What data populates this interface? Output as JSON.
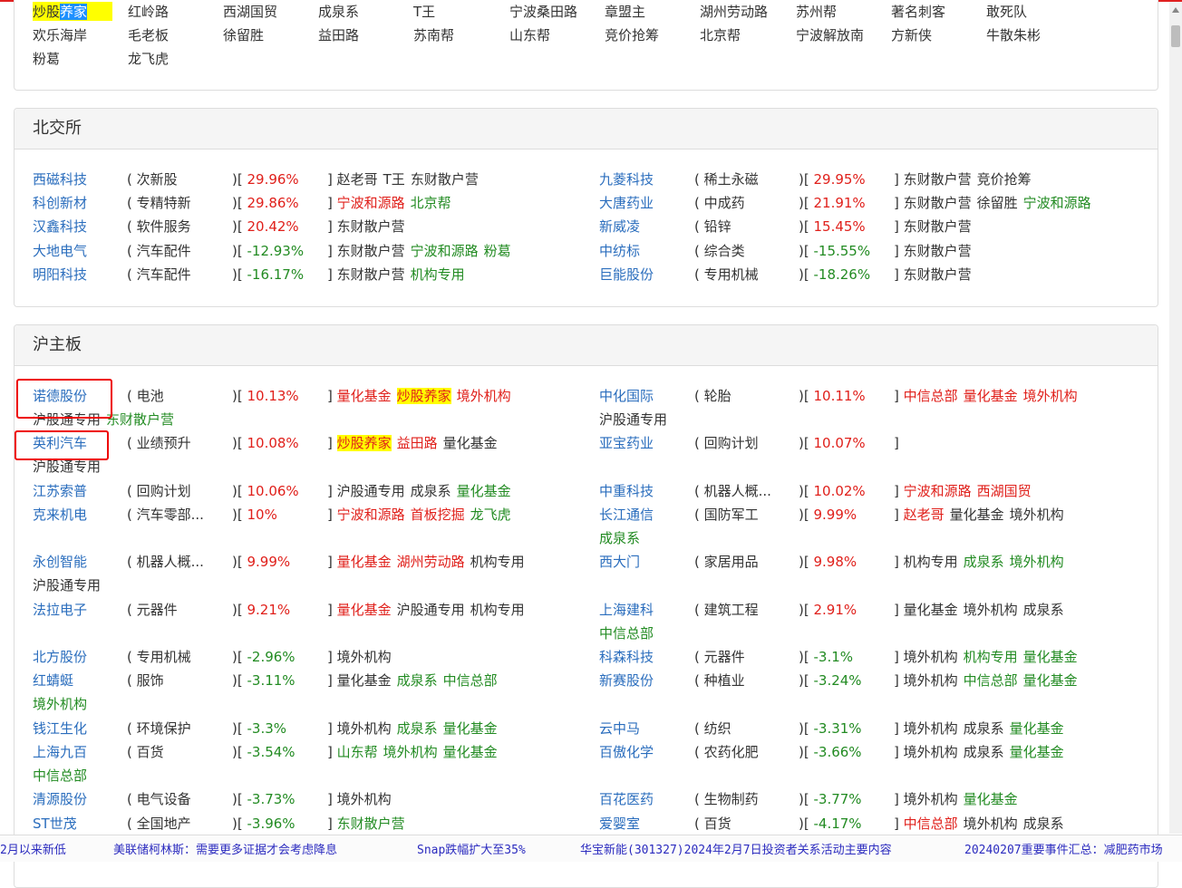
{
  "seats": [
    [
      "炒股养家",
      "红岭路",
      "西湖国贸",
      "成泉系",
      "T王",
      "宁波桑田路",
      "章盟主",
      "湖州劳动路",
      "苏州帮",
      "著名刺客",
      "敢死队"
    ],
    [
      "欢乐海岸",
      "毛老板",
      "徐留胜",
      "益田路",
      "苏南帮",
      "山东帮",
      "竞价抢筹",
      "北京帮",
      "宁波解放南",
      "方新侠",
      "牛散朱彬"
    ],
    [
      "粉葛",
      "龙飞虎"
    ]
  ],
  "sections": [
    {
      "title": "北交所",
      "rows": [
        {
          "left": {
            "name": "西磁科技",
            "industry": "次新股",
            "pct": "29.96%",
            "dir": "up",
            "tags": [
              {
                "t": "赵老哥",
                "c": "black"
              },
              {
                "t": "T王",
                "c": "black"
              },
              {
                "t": "东财散户营",
                "c": "black"
              }
            ]
          },
          "right": {
            "name": "九菱科技",
            "industry": "稀土永磁",
            "pct": "29.95%",
            "dir": "up",
            "tags": [
              {
                "t": "东财散户营",
                "c": "black"
              },
              {
                "t": "竞价抢筹",
                "c": "black"
              }
            ]
          }
        },
        {
          "left": {
            "name": "科创新材",
            "industry": "专精特新",
            "pct": "29.86%",
            "dir": "up",
            "tags": [
              {
                "t": "宁波和源路",
                "c": "red"
              },
              {
                "t": "北京帮",
                "c": "green"
              }
            ]
          },
          "right": {
            "name": "大唐药业",
            "industry": "中成药",
            "pct": "21.91%",
            "dir": "up",
            "tags": [
              {
                "t": "东财散户营",
                "c": "black"
              },
              {
                "t": "徐留胜",
                "c": "black"
              },
              {
                "t": "宁波和源路",
                "c": "green"
              }
            ]
          }
        },
        {
          "left": {
            "name": "汉鑫科技",
            "industry": "软件服务",
            "pct": "20.42%",
            "dir": "up",
            "tags": [
              {
                "t": "东财散户营",
                "c": "black"
              }
            ]
          },
          "right": {
            "name": "新威凌",
            "industry": "铅锌",
            "pct": "15.45%",
            "dir": "up",
            "tags": [
              {
                "t": "东财散户营",
                "c": "black"
              }
            ]
          }
        },
        {
          "left": {
            "name": "大地电气",
            "industry": "汽车配件",
            "pct": "-12.93%",
            "dir": "dn",
            "tags": [
              {
                "t": "东财散户营",
                "c": "black"
              },
              {
                "t": "宁波和源路",
                "c": "green"
              },
              {
                "t": "粉葛",
                "c": "green"
              }
            ]
          },
          "right": {
            "name": "中纺标",
            "industry": "综合类",
            "pct": "-15.55%",
            "dir": "dn",
            "tags": [
              {
                "t": "东财散户营",
                "c": "black"
              }
            ]
          }
        },
        {
          "left": {
            "name": "明阳科技",
            "industry": "汽车配件",
            "pct": "-16.17%",
            "dir": "dn",
            "tags": [
              {
                "t": "东财散户营",
                "c": "black"
              },
              {
                "t": "机构专用",
                "c": "green"
              }
            ]
          },
          "right": {
            "name": "巨能股份",
            "industry": "专用机械",
            "pct": "-18.26%",
            "dir": "dn",
            "tags": [
              {
                "t": "东财散户营",
                "c": "black"
              }
            ]
          }
        }
      ]
    },
    {
      "title": "沪主板",
      "rows": [
        {
          "left": {
            "name": "诺德股份",
            "industry": "电池",
            "pct": "10.13%",
            "dir": "up",
            "tags": [
              {
                "t": "量化基金",
                "c": "red"
              },
              {
                "t": "炒股养家",
                "c": "hl"
              },
              {
                "t": "境外机构",
                "c": "red"
              }
            ]
          },
          "right": {
            "name": "中化国际",
            "industry": "轮胎",
            "pct": "10.11%",
            "dir": "up",
            "tags": [
              {
                "t": "中信总部",
                "c": "red"
              },
              {
                "t": "量化基金",
                "c": "red"
              },
              {
                "t": "境外机构",
                "c": "red"
              }
            ]
          },
          "lcont": [
            {
              "t": "沪股通专用",
              "c": "black"
            },
            {
              "t": "东财散户营",
              "c": "green"
            }
          ],
          "rcont": [
            {
              "t": "沪股通专用",
              "c": "black"
            }
          ]
        },
        {
          "left": {
            "name": "英利汽车",
            "industry": "业绩预升",
            "pct": "10.08%",
            "dir": "up",
            "tags": [
              {
                "t": "炒股养家",
                "c": "hl"
              },
              {
                "t": "益田路",
                "c": "red"
              },
              {
                "t": "量化基金",
                "c": "black"
              }
            ]
          },
          "right": {
            "name": "亚宝药业",
            "industry": "回购计划",
            "pct": "10.07%",
            "dir": "up",
            "tags": []
          },
          "lcont": [
            {
              "t": "沪股通专用",
              "c": "black"
            }
          ],
          "rcont": []
        },
        {
          "left": {
            "name": "江苏索普",
            "industry": "回购计划",
            "pct": "10.06%",
            "dir": "up",
            "tags": [
              {
                "t": "沪股通专用",
                "c": "black"
              },
              {
                "t": "成泉系",
                "c": "black"
              },
              {
                "t": "量化基金",
                "c": "green"
              }
            ]
          },
          "right": {
            "name": "中重科技",
            "industry": "机器人概...",
            "pct": "10.02%",
            "dir": "up",
            "tags": [
              {
                "t": "宁波和源路",
                "c": "red"
              },
              {
                "t": "西湖国贸",
                "c": "red"
              }
            ]
          }
        },
        {
          "left": {
            "name": "克来机电",
            "industry": "汽车零部...",
            "pct": "10%",
            "dir": "up",
            "tags": [
              {
                "t": "宁波和源路",
                "c": "red"
              },
              {
                "t": "首板挖掘",
                "c": "red"
              },
              {
                "t": "龙飞虎",
                "c": "green"
              }
            ]
          },
          "right": {
            "name": "长江通信",
            "industry": "国防军工",
            "pct": "9.99%",
            "dir": "up",
            "tags": [
              {
                "t": "赵老哥",
                "c": "red"
              },
              {
                "t": "量化基金",
                "c": "black"
              },
              {
                "t": "境外机构",
                "c": "black"
              }
            ]
          },
          "lcont": [],
          "rcont": [
            {
              "t": "成泉系",
              "c": "green"
            }
          ]
        },
        {
          "left": {
            "name": "永创智能",
            "industry": "机器人概...",
            "pct": "9.99%",
            "dir": "up",
            "tags": [
              {
                "t": "量化基金",
                "c": "red"
              },
              {
                "t": "湖州劳动路",
                "c": "red"
              },
              {
                "t": "机构专用",
                "c": "black"
              }
            ]
          },
          "right": {
            "name": "西大门",
            "industry": "家居用品",
            "pct": "9.98%",
            "dir": "up",
            "tags": [
              {
                "t": "机构专用",
                "c": "black"
              },
              {
                "t": "成泉系",
                "c": "green"
              },
              {
                "t": "境外机构",
                "c": "green"
              }
            ]
          },
          "lcont": [
            {
              "t": "沪股通专用",
              "c": "black"
            }
          ],
          "rcont": []
        },
        {
          "left": {
            "name": "法拉电子",
            "industry": "元器件",
            "pct": "9.21%",
            "dir": "up",
            "tags": [
              {
                "t": "量化基金",
                "c": "red"
              },
              {
                "t": "沪股通专用",
                "c": "black"
              },
              {
                "t": "机构专用",
                "c": "black"
              }
            ]
          },
          "right": {
            "name": "上海建科",
            "industry": "建筑工程",
            "pct": "2.91%",
            "dir": "up",
            "tags": [
              {
                "t": "量化基金",
                "c": "black"
              },
              {
                "t": "境外机构",
                "c": "black"
              },
              {
                "t": "成泉系",
                "c": "black"
              }
            ]
          },
          "lcont": [],
          "rcont": [
            {
              "t": "中信总部",
              "c": "green"
            }
          ]
        },
        {
          "left": {
            "name": "北方股份",
            "industry": "专用机械",
            "pct": "-2.96%",
            "dir": "dn",
            "tags": [
              {
                "t": "境外机构",
                "c": "black"
              }
            ]
          },
          "right": {
            "name": "科森科技",
            "industry": "元器件",
            "pct": "-3.1%",
            "dir": "dn",
            "tags": [
              {
                "t": "境外机构",
                "c": "black"
              },
              {
                "t": "机构专用",
                "c": "green"
              },
              {
                "t": "量化基金",
                "c": "green"
              }
            ]
          }
        },
        {
          "left": {
            "name": "红蜻蜓",
            "industry": "服饰",
            "pct": "-3.11%",
            "dir": "dn",
            "tags": [
              {
                "t": "量化基金",
                "c": "black"
              },
              {
                "t": "成泉系",
                "c": "green"
              },
              {
                "t": "中信总部",
                "c": "green"
              }
            ]
          },
          "right": {
            "name": "新赛股份",
            "industry": "种植业",
            "pct": "-3.24%",
            "dir": "dn",
            "tags": [
              {
                "t": "境外机构",
                "c": "black"
              },
              {
                "t": "中信总部",
                "c": "green"
              },
              {
                "t": "量化基金",
                "c": "green"
              }
            ]
          },
          "lcont": [
            {
              "t": "境外机构",
              "c": "green"
            }
          ],
          "rcont": []
        },
        {
          "left": {
            "name": "钱江生化",
            "industry": "环境保护",
            "pct": "-3.3%",
            "dir": "dn",
            "tags": [
              {
                "t": "境外机构",
                "c": "black"
              },
              {
                "t": "成泉系",
                "c": "green"
              },
              {
                "t": "量化基金",
                "c": "green"
              }
            ]
          },
          "right": {
            "name": "云中马",
            "industry": "纺织",
            "pct": "-3.31%",
            "dir": "dn",
            "tags": [
              {
                "t": "境外机构",
                "c": "black"
              },
              {
                "t": "成泉系",
                "c": "black"
              },
              {
                "t": "量化基金",
                "c": "green"
              }
            ]
          }
        },
        {
          "left": {
            "name": "上海九百",
            "industry": "百货",
            "pct": "-3.54%",
            "dir": "dn",
            "tags": [
              {
                "t": "山东帮",
                "c": "green"
              },
              {
                "t": "境外机构",
                "c": "green"
              },
              {
                "t": "量化基金",
                "c": "green"
              }
            ]
          },
          "right": {
            "name": "百傲化学",
            "industry": "农药化肥",
            "pct": "-3.66%",
            "dir": "dn",
            "tags": [
              {
                "t": "境外机构",
                "c": "black"
              },
              {
                "t": "成泉系",
                "c": "black"
              },
              {
                "t": "量化基金",
                "c": "green"
              }
            ]
          },
          "lcont": [
            {
              "t": "中信总部",
              "c": "green"
            }
          ],
          "rcont": []
        },
        {
          "left": {
            "name": "清源股份",
            "industry": "电气设备",
            "pct": "-3.73%",
            "dir": "dn",
            "tags": [
              {
                "t": "境外机构",
                "c": "black"
              }
            ]
          },
          "right": {
            "name": "百花医药",
            "industry": "生物制药",
            "pct": "-3.77%",
            "dir": "dn",
            "tags": [
              {
                "t": "境外机构",
                "c": "black"
              },
              {
                "t": "量化基金",
                "c": "green"
              }
            ]
          }
        },
        {
          "left": {
            "name": "ST世茂",
            "industry": "全国地产",
            "pct": "-3.96%",
            "dir": "dn",
            "tags": [
              {
                "t": "东财散户营",
                "c": "green"
              }
            ]
          },
          "right": {
            "name": "爱婴室",
            "industry": "百货",
            "pct": "-4.17%",
            "dir": "dn",
            "tags": [
              {
                "t": "中信总部",
                "c": "red"
              },
              {
                "t": "境外机构",
                "c": "black"
              },
              {
                "t": "成泉系",
                "c": "black"
              }
            ]
          }
        }
      ]
    }
  ],
  "ticker": [
    "2月以来新低",
    "美联储柯林斯：需要更多证据才会考虑降息",
    "Snap跌幅扩大至35%",
    "华宝新能(301327)2024年2月7日投资者关系活动主要内容",
    "20240207重要事件汇总：减肥药市场"
  ],
  "colors": {
    "up": "#e0201b",
    "down": "#228b22",
    "link": "#2a6dbd",
    "highlight": "#ffff00"
  }
}
